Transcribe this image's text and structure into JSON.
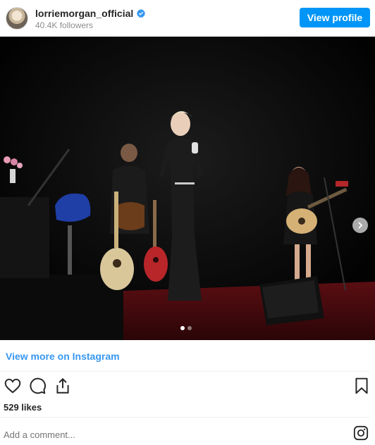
{
  "header": {
    "username": "lorriemorgan_official",
    "followers": "40.4K followers",
    "view_profile_label": "View profile",
    "verified_icon": "verified-badge-icon"
  },
  "post": {
    "carousel": {
      "total": 2,
      "current": 1
    }
  },
  "footer": {
    "view_more_label": "View more on Instagram",
    "likes": "529 likes",
    "comment_placeholder": "Add a comment...",
    "icons": [
      "heart-icon",
      "comment-icon",
      "share-icon",
      "bookmark-icon",
      "instagram-logo-icon"
    ]
  },
  "colors": {
    "accent": "#0095f6",
    "link": "#3897f0",
    "stage_floor": "#7a1418"
  }
}
